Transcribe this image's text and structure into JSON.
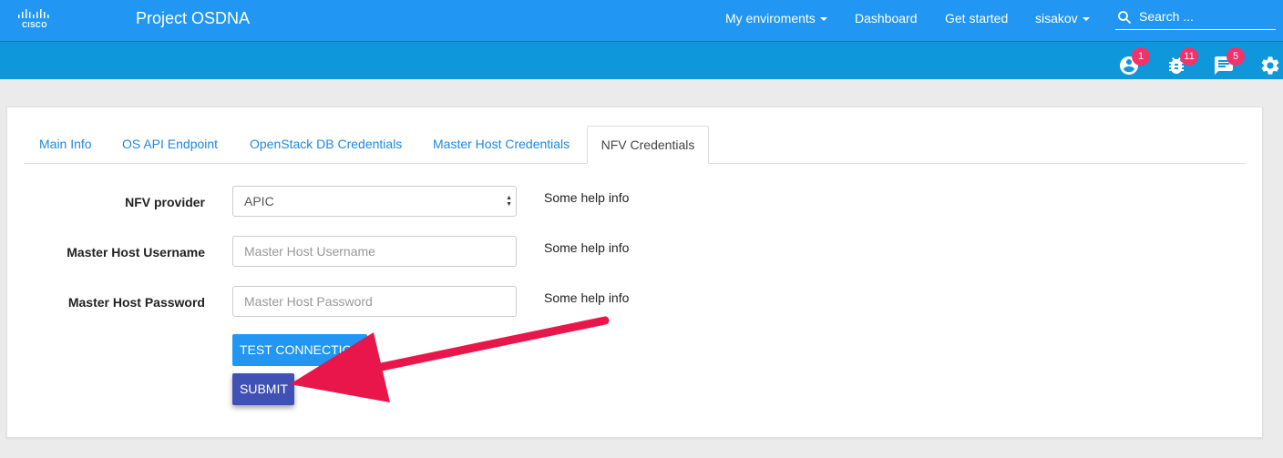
{
  "header": {
    "logo_text": "CISCO",
    "brand": "Project OSDNA",
    "nav": {
      "environments": "My enviroments",
      "dashboard": "Dashboard",
      "get_started": "Get started",
      "user": "sisakov"
    },
    "search": {
      "placeholder": "Search ..."
    }
  },
  "toolbar": {
    "notifications": [
      {
        "icon": "account-circle-icon",
        "count": "1"
      },
      {
        "icon": "bug-icon",
        "count": "11"
      },
      {
        "icon": "message-icon",
        "count": "5"
      },
      {
        "icon": "gear-icon"
      }
    ]
  },
  "tabs": [
    {
      "label": "Main Info"
    },
    {
      "label": "OS API Endpoint"
    },
    {
      "label": "OpenStack DB Credentials"
    },
    {
      "label": "Master Host Credentials"
    },
    {
      "label": "NFV Credentials",
      "active": true
    }
  ],
  "form": {
    "nfv_provider": {
      "label": "NFV provider",
      "value": "APIC",
      "help": "Some help info"
    },
    "master_host_username": {
      "label": "Master Host Username",
      "placeholder": "Master Host Username",
      "help": "Some help info"
    },
    "master_host_password": {
      "label": "Master Host Password",
      "placeholder": "Master Host Password",
      "help": "Some help info"
    },
    "test_connection_label": "TEST CONNECTION",
    "submit_label": "SUBMIT"
  },
  "colors": {
    "navbar": "#2196f3",
    "subbar": "#0e98db",
    "badge": "#f0336b",
    "submit": "#3f51b5",
    "annotation_arrow": "#e8164a"
  }
}
